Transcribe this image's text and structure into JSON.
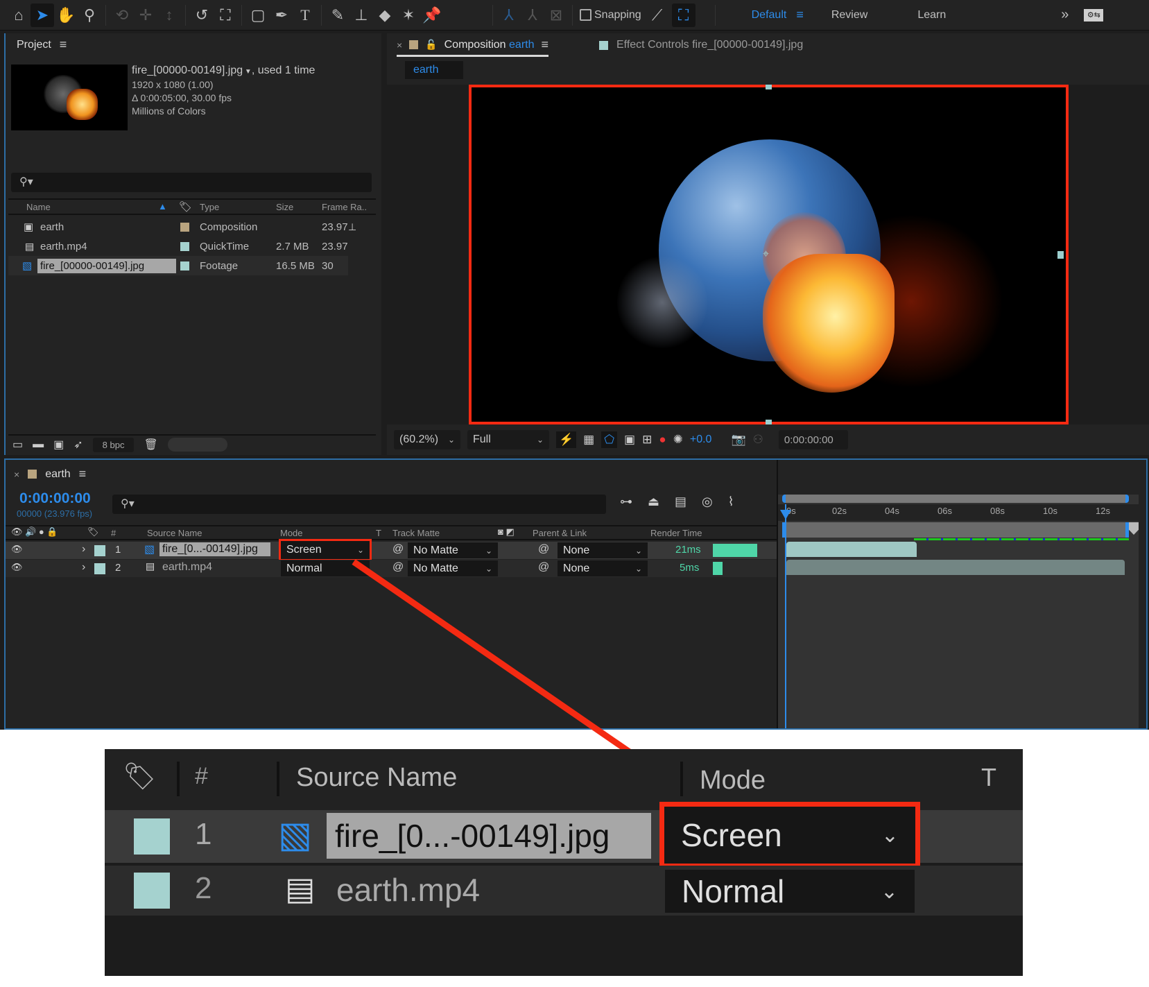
{
  "toolbar": {
    "tools": [
      "home-icon",
      "selection-icon",
      "hand-icon",
      "zoom-icon",
      "orbit-icon",
      "pan-icon",
      "dolly-icon",
      "rotate-icon",
      "anchor-icon",
      "rectangle-icon",
      "pen-icon",
      "type-icon",
      "brush-icon",
      "clone-stamp-icon",
      "eraser-icon",
      "roto-brush-icon",
      "puppet-pin-icon"
    ],
    "snapping_label": "Snapping",
    "workspaces": [
      {
        "label": "Default",
        "active": true
      },
      {
        "label": "Review",
        "active": false
      },
      {
        "label": "Learn",
        "active": false
      }
    ],
    "overflow": "»"
  },
  "project": {
    "title": "Project",
    "selected_item": {
      "name": "fire_[00000-00149].jpg",
      "usage": ", used 1 time",
      "dimensions": "1920 x 1080 (1.00)",
      "duration": "Δ 0:00:05:00, 30.00 fps",
      "color_depth": "Millions of Colors"
    },
    "search_placeholder": "",
    "columns": [
      "Name",
      "Type",
      "Size",
      "Frame Ra.."
    ],
    "items": [
      {
        "name": "earth",
        "label_color": "#b9a47f",
        "type": "Composition",
        "size": "",
        "frame_rate": "23.97",
        "icon": "composition-icon"
      },
      {
        "name": "earth.mp4",
        "label_color": "#a5d2cf",
        "type": "QuickTime",
        "size": "2.7 MB",
        "frame_rate": "23.97",
        "icon": "video-file-icon"
      },
      {
        "name": "fire_[00000-00149].jpg",
        "label_color": "#a5d2cf",
        "type": "Footage",
        "size": "16.5 MB",
        "frame_rate": "30",
        "icon": "image-sequence-icon",
        "selected": true
      }
    ],
    "bit_depth": "8 bpc"
  },
  "composition": {
    "tab_prefix": "Composition",
    "tab_name": "earth",
    "effect_controls_tab": "Effect Controls fire_[00000-00149].jpg",
    "breadcrumb": "earth",
    "zoom": "(60.2%)",
    "resolution": "Full",
    "exposure": "+0.0",
    "timecode": "0:00:00:00"
  },
  "timeline": {
    "tab_name": "earth",
    "current_time": "0:00:00:00",
    "frame_info": "00000 (23.976 fps)",
    "columns": {
      "source_name": "Source Name",
      "mode": "Mode",
      "t": "T",
      "track_matte": "Track Matte",
      "parent": "Parent & Link",
      "render_time": "Render Time"
    },
    "ruler": [
      "0s",
      "02s",
      "04s",
      "06s",
      "08s",
      "10s",
      "12s"
    ],
    "layers": [
      {
        "index": "1",
        "name": "fire_[0...-00149].jpg",
        "mode": "Screen",
        "track_matte": "No Matte",
        "parent": "None",
        "render_time": "21ms",
        "render_fraction": 1.0,
        "bar_end_fraction": 0.385,
        "selected": true
      },
      {
        "index": "2",
        "name": "earth.mp4",
        "mode": "Normal",
        "track_matte": "No Matte",
        "parent": "None",
        "render_time": "5ms",
        "render_fraction": 0.2,
        "bar_end_fraction": 1.0
      }
    ]
  },
  "inset": {
    "columns": {
      "hash": "#",
      "source_name": "Source Name",
      "mode": "Mode",
      "t": "T"
    },
    "layers": [
      {
        "index": "1",
        "name": "fire_[0...-00149].jpg",
        "mode": "Screen"
      },
      {
        "index": "2",
        "name": "earth.mp4",
        "mode": "Normal"
      }
    ]
  },
  "colors": {
    "accent": "#2d8ceb",
    "highlight": "#f42a12",
    "label_teal": "#a5d2cf",
    "label_tan": "#b9a47f",
    "render_bar": "#4fd6a8"
  }
}
